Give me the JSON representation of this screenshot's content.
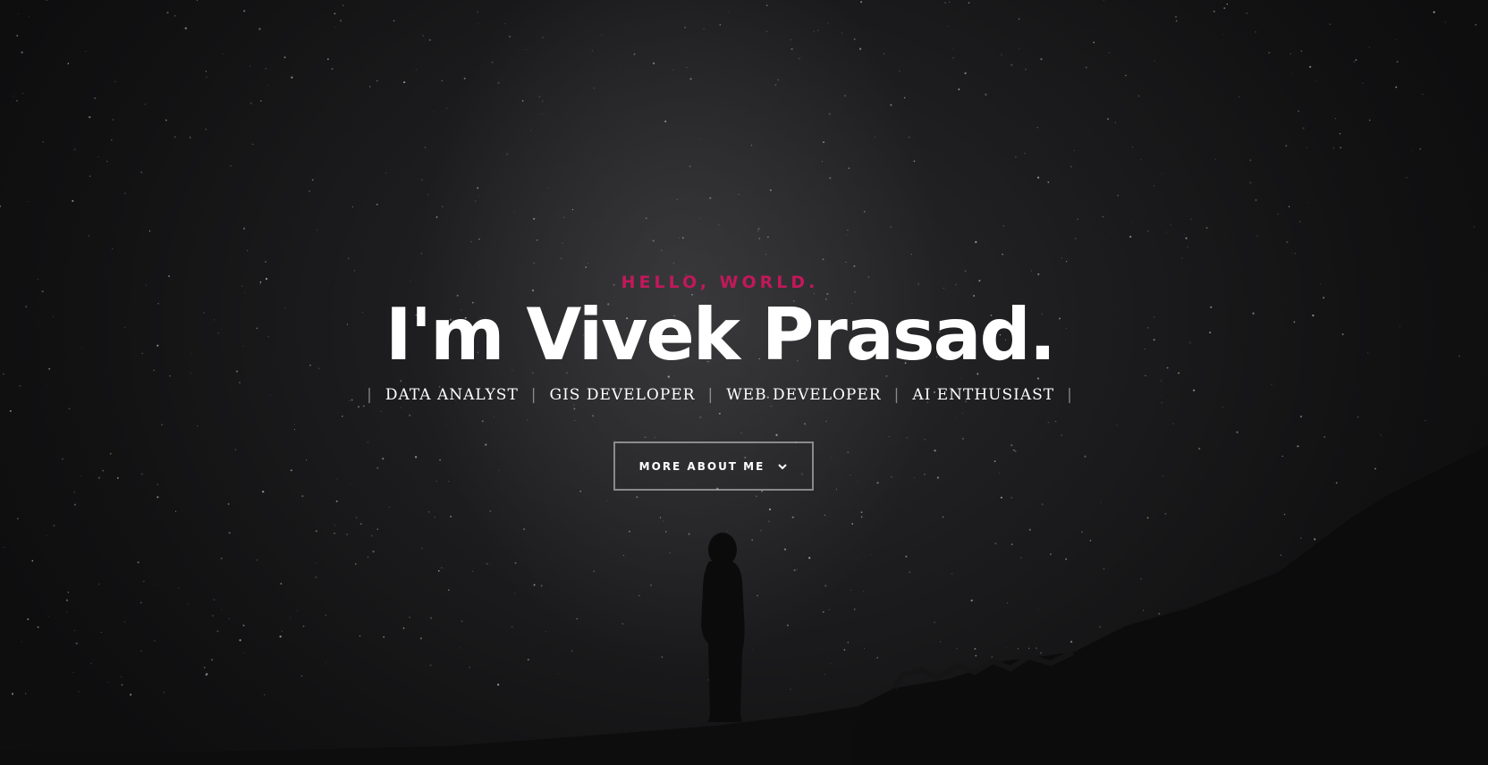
{
  "hero": {
    "greeting": "HELLO, WORLD.",
    "title": "I'm Vivek Prasad.",
    "roles": [
      "DATA ANALYST",
      "GIS DEVELOPER",
      "WEB DEVELOPER",
      "AI ENTHUSIAST"
    ],
    "separator": "|",
    "cta_label": "MORE ABOUT ME",
    "cta_icon": "chevron-down-icon"
  },
  "colors": {
    "accent": "#c2185b",
    "background": "#0f0f10",
    "text": "#ffffff"
  }
}
